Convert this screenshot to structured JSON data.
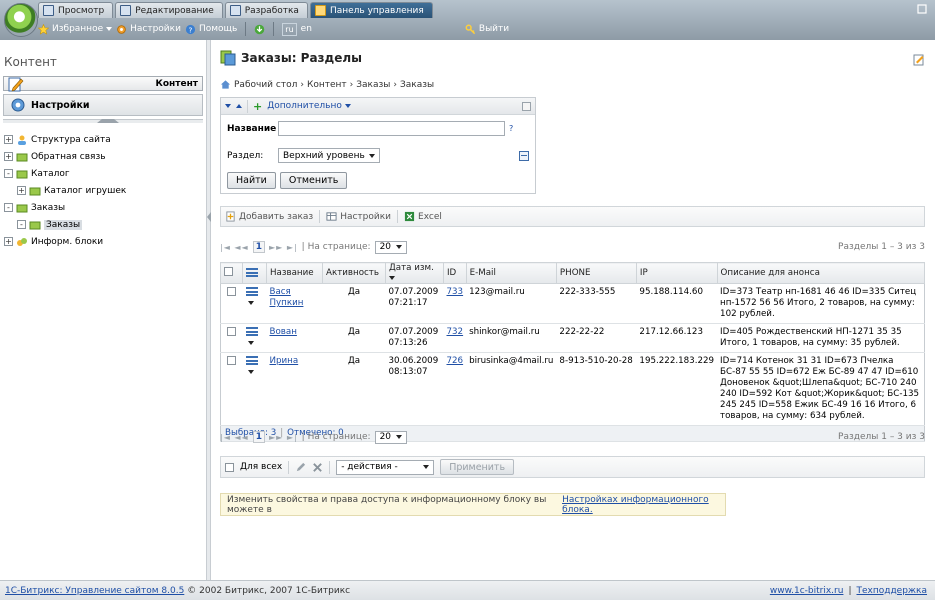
{
  "tabs": [
    {
      "label": "Просмотр",
      "active": false
    },
    {
      "label": "Редактирование",
      "active": false
    },
    {
      "label": "Разработка",
      "active": false
    },
    {
      "label": "Панель управления",
      "active": true
    }
  ],
  "toolbar": {
    "favorites": "Избранное",
    "settings": "Настройки",
    "help": "Помощь",
    "lang_ru": "ru",
    "lang_en": "en",
    "logout": "Выйти"
  },
  "left": {
    "title": "Контент",
    "buttons": [
      {
        "label": "Контент"
      },
      {
        "label": "Настройки"
      }
    ],
    "tree": [
      {
        "label": "Структура сайта",
        "toggle": "+"
      },
      {
        "label": "Обратная связь",
        "toggle": "+"
      },
      {
        "label": "Каталог",
        "toggle": "-"
      },
      {
        "label": "Каталог игрушек",
        "toggle": "+"
      },
      {
        "label": "Заказы",
        "toggle": "-"
      },
      {
        "label": "Заказы",
        "toggle": "-"
      },
      {
        "label": "Информ. блоки",
        "toggle": "+"
      }
    ]
  },
  "page": {
    "title": "Заказы: Разделы",
    "breadcrumb": [
      "Рабочий стол",
      "Контент",
      "Заказы",
      "Заказы"
    ],
    "sep": "›"
  },
  "filter": {
    "more": "Дополнительно",
    "name_label": "Название",
    "name_value": "",
    "help": "?",
    "section_label": "Раздел:",
    "section_value": "Верхний уровень",
    "find": "Найти",
    "cancel": "Отменить"
  },
  "context": {
    "add": "Добавить заказ",
    "settings": "Настройки",
    "excel": "Excel"
  },
  "nav": {
    "page": "1",
    "per_page_label": "| На странице:",
    "per_page": "20",
    "summary": "Разделы 1 – 3 из 3"
  },
  "grid": {
    "headers": [
      "Название",
      "Активность",
      "Дата изм.",
      "ID",
      "E-Mail",
      "PHONE",
      "IP",
      "Описание для анонса"
    ],
    "rows": [
      {
        "name": "Вася Пупкин",
        "active": "Да",
        "date": "07.07.2009",
        "time": "07:21:17",
        "id": "733",
        "email": "123@mail.ru",
        "phone": "222-333-555",
        "ip": "95.188.114.60",
        "desc": "ID=373 Театр нп-1681 46 46 ID=335 Ситец нп-1572 56 56 Итого, 2 товаров, на сумму: 102 рублей."
      },
      {
        "name": "Вован",
        "active": "Да",
        "date": "07.07.2009",
        "time": "07:13:26",
        "id": "732",
        "email": "shinkor@mail.ru",
        "phone": "222-22-22",
        "ip": "217.12.66.123",
        "desc": "ID=405 Рождественский НП-1271 35 35 Итого, 1 товаров, на сумму: 35 рублей."
      },
      {
        "name": "Ирина",
        "active": "Да",
        "date": "30.06.2009",
        "time": "08:13:07",
        "id": "726",
        "email": "birusinka@4mail.ru",
        "phone": "8-913-510-20-28",
        "ip": "195.222.183.229",
        "desc": "ID=714 Котенок 31 31 ID=673 Пчелка БС-87 55 55 ID=672 Еж БС-89 47 47 ID=610 Доновенок &quot;Шлепа&quot; БС-710 240 240 ID=592 Кот &quot;Жорик&quot; БС-135 245 245 ID=558 Ежик БС-49 16 16 Итого, 6 товаров, на сумму: 634 рублей."
      }
    ],
    "selected": "Выбрано: 3",
    "checked": "Отмечено: 0"
  },
  "actions": {
    "for_all": "Для всех",
    "select": "- действия -",
    "apply": "Применить"
  },
  "note": {
    "text": "Изменить свойства и права доступа к информационному блоку вы можете в ",
    "link": "Настройках информационного блока."
  },
  "status": {
    "product": "1С-Битрикс: Управление сайтом 8.0.5",
    "copyright": "© 2002 Битрикс, 2007 1С-Битрикс",
    "site": "www.1c-bitrix.ru",
    "sep": "|",
    "support": "Техподдержка"
  }
}
